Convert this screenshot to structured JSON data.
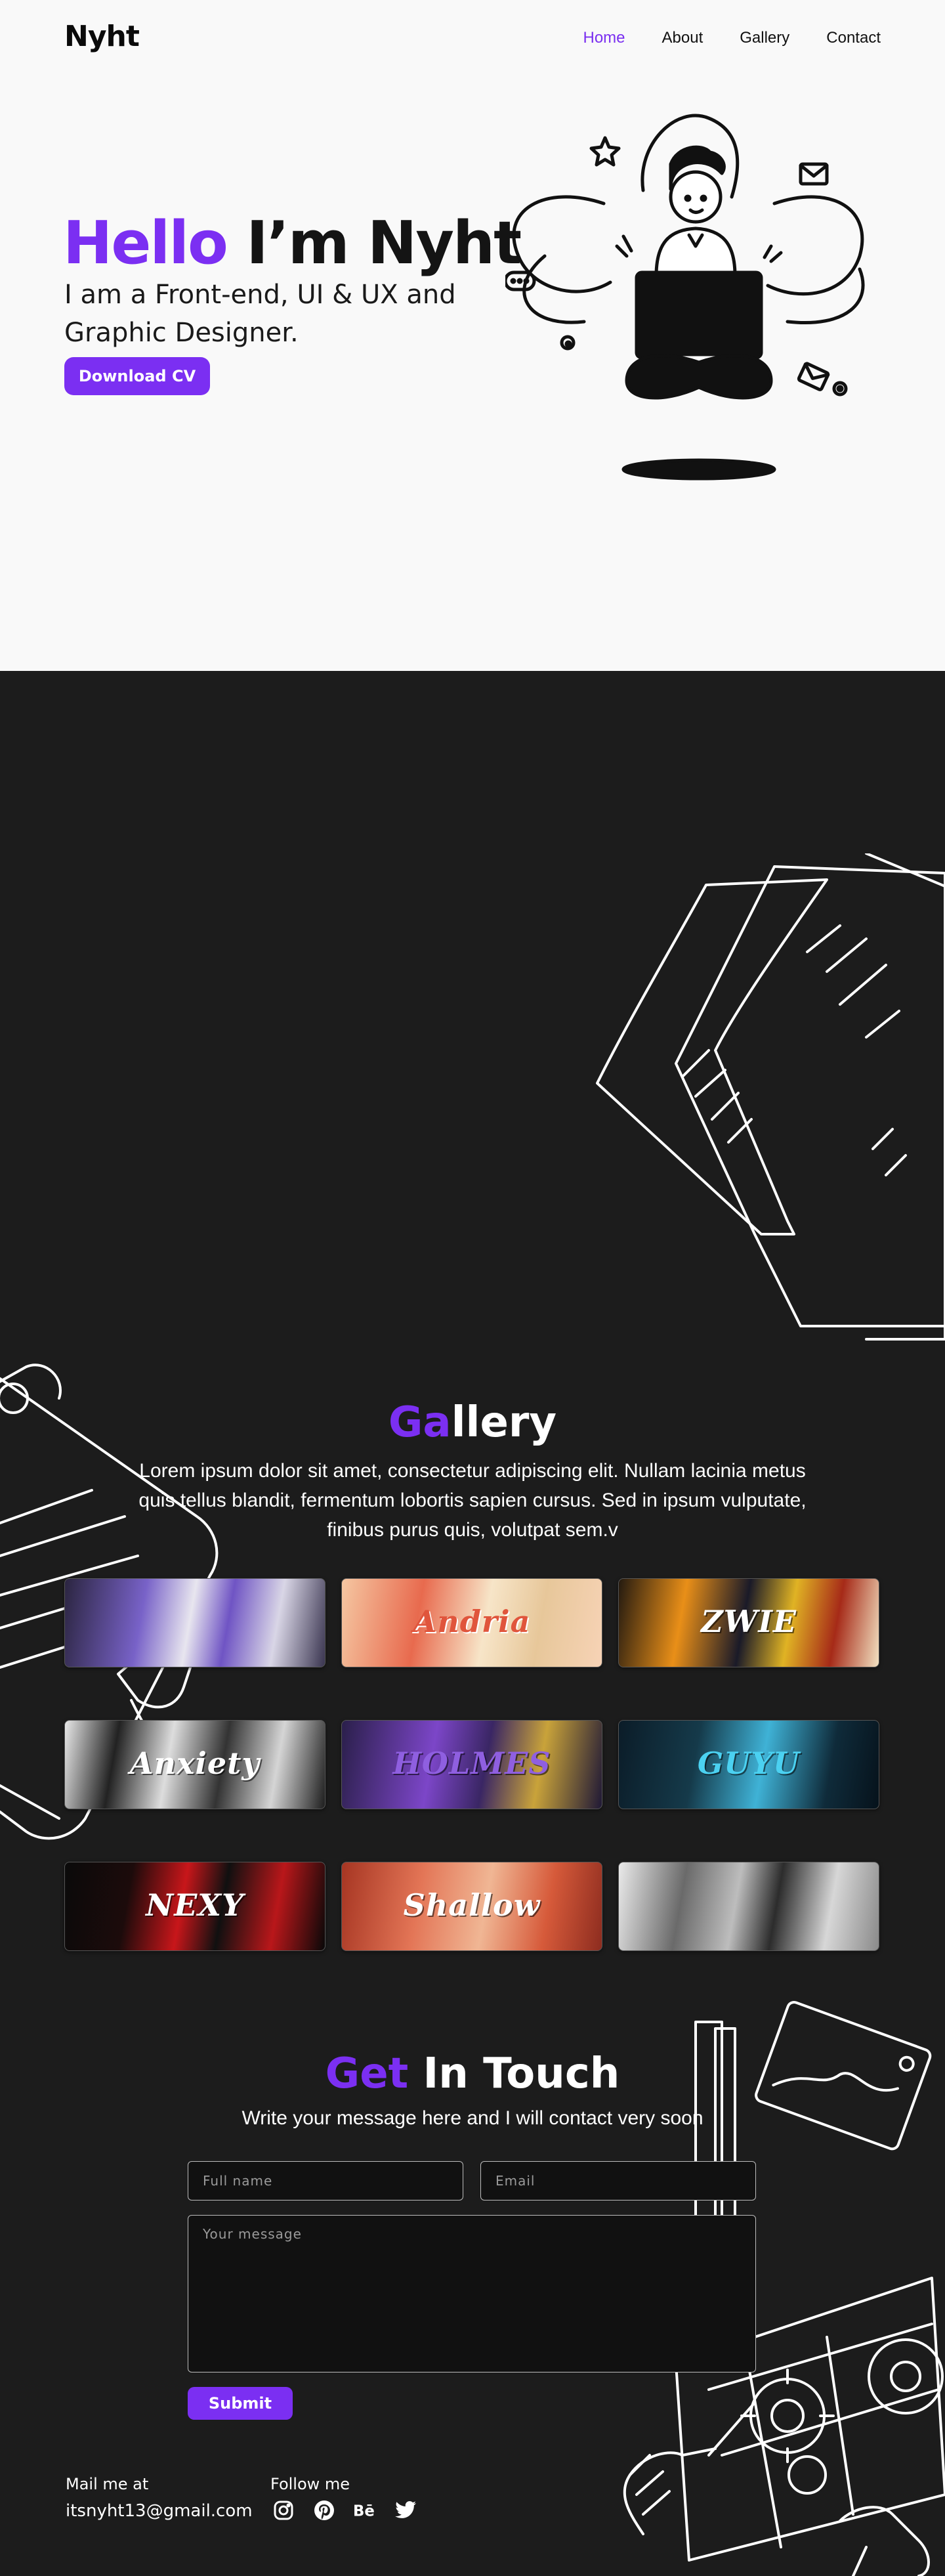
{
  "header": {
    "logo": "Nyht",
    "nav": [
      {
        "label": "Home",
        "active": true
      },
      {
        "label": "About",
        "active": false
      },
      {
        "label": "Gallery",
        "active": false
      },
      {
        "label": "Contact",
        "active": false
      }
    ]
  },
  "hero": {
    "greeting_accent": "Hello",
    "greeting_rest": "I’m Nyht",
    "subtitle": "I am a Front-end, UI & UX and Graphic Designer.",
    "cta": "Download CV"
  },
  "gallery": {
    "title_accent": "Ga",
    "title_rest": "llery",
    "description": "Lorem ipsum dolor sit amet, consectetur adipiscing elit. Nullam lacinia metus quis tellus blandit, fermentum lobortis sapien cursus. Sed in ipsum vulputate, finibus purus quis, volutpat sem.v",
    "items": [
      {
        "label": ""
      },
      {
        "label": "Andria"
      },
      {
        "label": "ZWIE"
      },
      {
        "label": "Anxiety"
      },
      {
        "label": "HOLMES"
      },
      {
        "label": "GUYU"
      },
      {
        "label": "NEXY"
      },
      {
        "label": "Shallow"
      },
      {
        "label": ""
      }
    ]
  },
  "contact": {
    "title_accent": "Get",
    "title_rest": "In Touch",
    "subtitle": "Write your message here and I will contact very soon",
    "fullname_placeholder": "Full name",
    "email_placeholder": "Email",
    "message_placeholder": "Your message",
    "submit": "Submit"
  },
  "footer": {
    "mail_label": "Mail me at",
    "mail": "itsnyht13@gmail.com",
    "follow_label": "Follow me",
    "socials": [
      "instagram-icon",
      "pinterest-icon",
      "behance-icon",
      "twitter-icon"
    ]
  },
  "colors": {
    "accent": "#7b2ff2",
    "dark_bg": "#1c1c1c",
    "light_bg": "#f9f9f9"
  }
}
